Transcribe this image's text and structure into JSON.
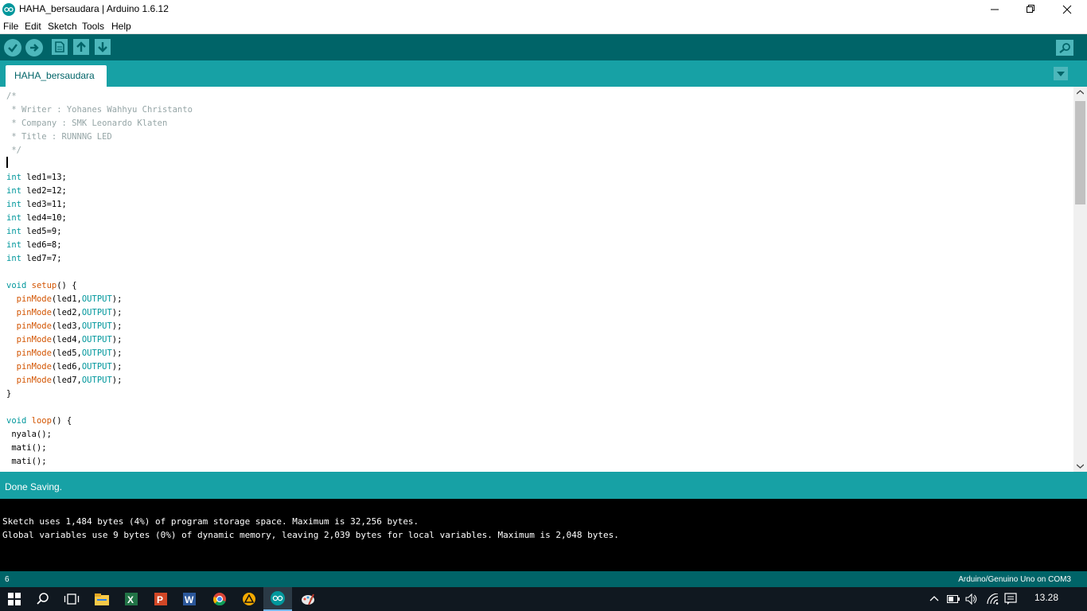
{
  "window": {
    "title": "HAHA_bersaudara | Arduino 1.6.12"
  },
  "menu": {
    "items": [
      "File",
      "Edit",
      "Sketch",
      "Tools",
      "Help"
    ]
  },
  "toolbar": {
    "verify_icon": "check-icon",
    "upload_icon": "arrow-right-icon",
    "new_icon": "new-file-icon",
    "open_icon": "arrow-up-icon",
    "save_icon": "arrow-down-icon",
    "serial_monitor_icon": "magnifier-icon"
  },
  "tabs": [
    {
      "label": "HAHA_bersaudara"
    }
  ],
  "editor": {
    "lines": [
      "/*",
      " * Writer : Yohanes Wahhyu Christanto",
      " * Company : SMK Leonardo Klaten",
      " * Title : RUNNNG LED",
      " */",
      "",
      "int led1=13;",
      "int led2=12;",
      "int led3=11;",
      "int led4=10;",
      "int led5=9;",
      "int led6=8;",
      "int led7=7;",
      "",
      "void setup() {",
      "  pinMode(led1,OUTPUT);",
      "  pinMode(led2,OUTPUT);",
      "  pinMode(led3,OUTPUT);",
      "  pinMode(led4,OUTPUT);",
      "  pinMode(led5,OUTPUT);",
      "  pinMode(led6,OUTPUT);",
      "  pinMode(led7,OUTPUT);",
      "}",
      "",
      "void loop() {",
      " nyala();",
      " mati();",
      " mati();"
    ]
  },
  "status": {
    "message": "Done Saving."
  },
  "console": {
    "lines": [
      "Sketch uses 1,484 bytes (4%) of program storage space. Maximum is 32,256 bytes.",
      "Global variables use 9 bytes (0%) of dynamic memory, leaving 2,039 bytes for local variables. Maximum is 2,048 bytes."
    ]
  },
  "infobar": {
    "line_number": "6",
    "board": "Arduino/Genuino Uno on COM3"
  },
  "taskbar": {
    "clock": "13.28"
  },
  "colors": {
    "teal_dark": "#006468",
    "teal": "#17a1a5",
    "comment": "#95a5a6",
    "keyword": "#00979c",
    "function": "#d35400"
  }
}
